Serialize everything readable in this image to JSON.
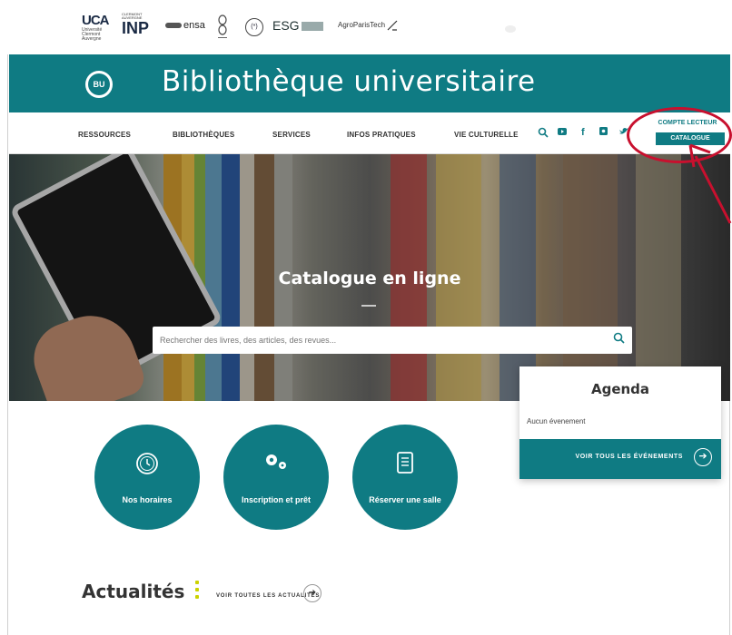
{
  "logos": {
    "uca_mark": "UCA",
    "uca_sub": "Université Clermont Auvergne",
    "inp_small": "CLERMONT AUVERGNE",
    "inp_big": "INP",
    "ensa": "ensa",
    "esg": "ESG",
    "agro": "AgroParisTech"
  },
  "header": {
    "badge": "BU",
    "title": "Bibliothèque universitaire"
  },
  "nav": {
    "items": [
      "RESSOURCES",
      "BIBLIOTHÈQUES",
      "SERVICES",
      "INFOS PRATIQUES",
      "VIE CULTURELLE"
    ],
    "compte": "COMPTE LECTEUR",
    "catalogue": "CATALOGUE"
  },
  "hero": {
    "title": "Catalogue en ligne",
    "search_placeholder": "Rechercher des livres, des articles, des revues..."
  },
  "agenda": {
    "title": "Agenda",
    "empty": "Aucun évenement",
    "link": "VOIR TOUS LES ÉVÉNEMENTS"
  },
  "tiles": [
    {
      "label": "Nos horaires",
      "icon": "clock-icon"
    },
    {
      "label": "Inscription et prêt",
      "icon": "gears-icon"
    },
    {
      "label": "Réserver une salle",
      "icon": "book-icon"
    }
  ],
  "news": {
    "title": "Actualités",
    "link": "VOIR TOUTES LES ACTUALITES"
  },
  "colors": {
    "brand": "#0f7b83",
    "highlight": "#c8102e",
    "accent": "#ccd200"
  }
}
